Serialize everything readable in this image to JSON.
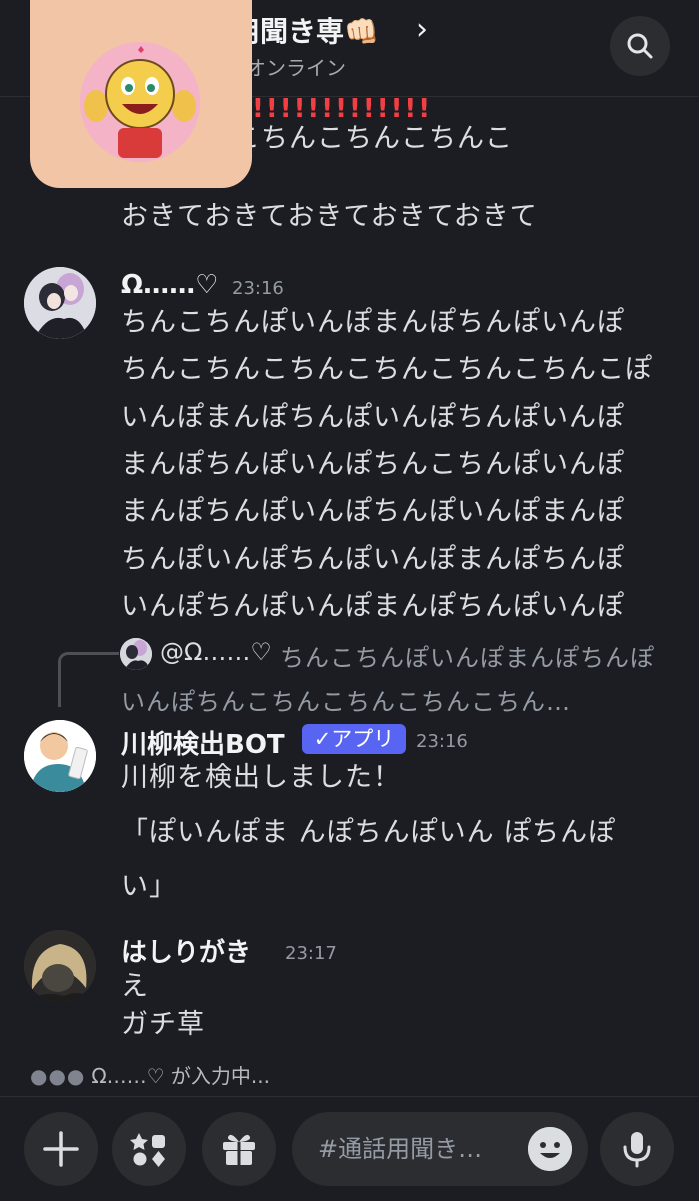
{
  "header": {
    "title": "用聞き専👊🏻",
    "chevron": "›",
    "status": "オンライン"
  },
  "messages": [
    {
      "exclam": "!!!!!!!!!!!!!",
      "lines": [
        "んこちんこちんこちんこちんこ",
        "おきておきておきておきておきて"
      ]
    },
    {
      "author": "Ω……♡",
      "time": "23:16",
      "lines": [
        "ちんこちんぽいんぽまんぽちんぽいんぽ",
        "ちんこちんこちんこちんこちんこちんこぽ",
        "いんぽまんぽちんぽいんぽちんぽいんぽ",
        "まんぽちんぽいんぽちんこちんぽいんぽ",
        "まんぽちんぽいんぽちんぽいんぽまんぽ",
        "ちんぽいんぽちんぽいんぽまんぽちんぽ",
        "いんぽちんぽいんぽまんぽちんぽいんぽ"
      ]
    },
    {
      "reply": {
        "author": "@Ω……♡",
        "text_line1": "ちんこちんぽいんぽまんぽちんぽ",
        "text_line2": "いんぽちんこちんこちんこちんこちん…"
      },
      "author": "川柳検出BOT",
      "badge": "✓アプリ",
      "time": "23:16",
      "lines": [
        "川柳を検出しました！",
        "「ぽいんぽま んぽちんぽいん ぽちんぽ",
        "い」"
      ]
    },
    {
      "author": "はしりがき",
      "time": "23:17",
      "lines": [
        "え",
        "ガチ草"
      ]
    }
  ],
  "typing": {
    "dots": "●●●",
    "text": "Ω……♡ が入力中..."
  },
  "composer": {
    "placeholder": "#通話用聞き…",
    "plus_icon": "plus-icon",
    "apps_icon": "apps-icon",
    "gift_icon": "gift-icon",
    "emoji_icon": "emoji-icon",
    "mic_icon": "microphone-icon"
  },
  "colors": {
    "background": "#1c1d22",
    "accent": "#5865f2",
    "alert": "#f23f43",
    "muted_text": "#949ba4",
    "server_card": "#f1c5a5"
  }
}
